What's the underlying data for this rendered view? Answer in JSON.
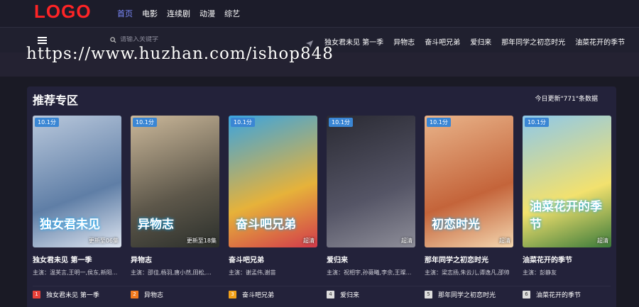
{
  "header": {
    "logo": "LOGO",
    "nav": [
      "首页",
      "电影",
      "连续剧",
      "动漫",
      "综艺"
    ],
    "active_index": 0
  },
  "subbar": {
    "search_placeholder": "请输入关键字",
    "hot_links": [
      "独女君未见 第一季",
      "异物志",
      "奋斗吧兄弟",
      "爱归来",
      "那年同学之初恋时光",
      "油菜花开的季节"
    ]
  },
  "watermark": "https://www.huzhan.com/ishop848",
  "section": {
    "title": "推荐专区",
    "update_stat": "今日更新\"771\"条数据",
    "cards": [
      {
        "badge": "10.1分",
        "note": "更新至06集",
        "title": "独女君未见 第一季",
        "cast": "主演：温芙言,王明一,侯东,新阳...",
        "art": "独女君未见",
        "colors": [
          "#b9c8dc",
          "#5f7ea6",
          "#dfe6f1"
        ]
      },
      {
        "badge": "10.1分",
        "note": "更新至18集",
        "title": "异物志",
        "cast": "主演：邵佳,杨羽,唐小然,田松,...",
        "art": "异物志",
        "colors": [
          "#cbb89a",
          "#5d574a",
          "#2b2f2b"
        ]
      },
      {
        "badge": "10.1分",
        "note": "超清",
        "title": "奋斗吧兄弟",
        "cast": "主演：谢孟伟,谢苗",
        "art": "奋斗吧兄弟",
        "colors": [
          "#3aa4e0",
          "#e6b23a",
          "#d23a4b"
        ]
      },
      {
        "badge": "10.1分",
        "note": "超清",
        "title": "爱归来",
        "cast": "主演：祝相宇,孙薇曦,李余,王璨...",
        "art": "",
        "colors": [
          "#2a2a33",
          "#555566",
          "#8e8e99"
        ]
      },
      {
        "badge": "10.1分",
        "note": "超清",
        "title": "那年同学之初恋时光",
        "cast": "主演：梁志扬,朱云儿,谭逸凡,邵帅",
        "art": "初恋时光",
        "colors": [
          "#e9b48a",
          "#c4643a",
          "#f4d7b0"
        ]
      },
      {
        "badge": "10.1分",
        "note": "超清",
        "title": "油菜花开的季节",
        "cast": "主演：彭静友",
        "art": "油菜花开的季节",
        "colors": [
          "#8ec8ea",
          "#f2e16e",
          "#3a7a3a"
        ]
      }
    ],
    "rank": [
      {
        "num": "1",
        "title": "独女君未见 第一季",
        "color": "#e8413a"
      },
      {
        "num": "2",
        "title": "异物志",
        "color": "#f07a1e"
      },
      {
        "num": "3",
        "title": "奋斗吧兄弟",
        "color": "#f2a11a"
      },
      {
        "num": "4",
        "title": "爱归来",
        "color": ""
      },
      {
        "num": "5",
        "title": "那年同学之初恋时光",
        "color": ""
      },
      {
        "num": "6",
        "title": "油菜花开的季节",
        "color": ""
      }
    ]
  }
}
